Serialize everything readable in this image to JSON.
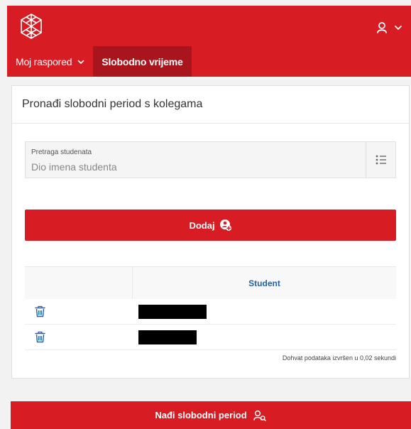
{
  "brand": {
    "logo_icon": "cube-network-logo-icon",
    "accent_color": "#d81c24",
    "active_tab_color": "#a8151c",
    "link_color": "#1f62b0"
  },
  "header": {
    "user_icon": "user-icon",
    "dropdown_icon": "chevron-down-icon"
  },
  "nav": {
    "items": [
      {
        "label": "Moj raspored",
        "has_dropdown": true,
        "active": false
      },
      {
        "label": "Slobodno vrijeme",
        "has_dropdown": false,
        "active": true
      }
    ]
  },
  "card": {
    "title": "Pronađi slobodni period s kolegama",
    "search": {
      "label": "Pretraga studenata",
      "placeholder": "Dio imena studenta",
      "button_icon": "list-icon"
    },
    "add_button": {
      "label": "Dodaj",
      "icon": "add-user-icon"
    },
    "table": {
      "columns": [
        "",
        "Student"
      ],
      "rows": [
        {
          "action_icon": "trash-icon",
          "student_redacted": true
        },
        {
          "action_icon": "trash-icon",
          "student_redacted": true
        }
      ]
    },
    "status_note": "Dohvat podataka izvršen u 0,02 sekundi"
  },
  "footer_button": {
    "label": "Nađi slobodni period",
    "icon": "search-user-icon"
  }
}
